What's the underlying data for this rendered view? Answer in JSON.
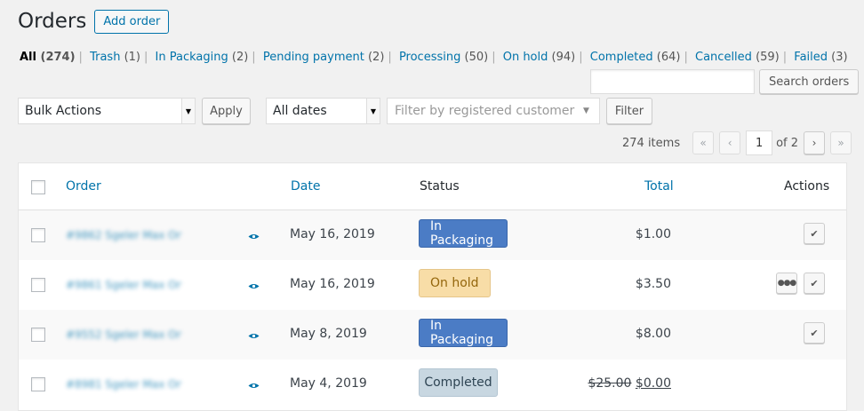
{
  "header": {
    "title": "Orders",
    "add_label": "Add order"
  },
  "filters": [
    {
      "label": "All",
      "count": "(274)",
      "current": true
    },
    {
      "label": "Trash",
      "count": "(1)"
    },
    {
      "label": "In Packaging",
      "count": "(2)"
    },
    {
      "label": "Pending payment",
      "count": "(2)"
    },
    {
      "label": "Processing",
      "count": "(50)"
    },
    {
      "label": "On hold",
      "count": "(94)"
    },
    {
      "label": "Completed",
      "count": "(64)"
    },
    {
      "label": "Cancelled",
      "count": "(59)"
    },
    {
      "label": "Failed",
      "count": "(3)"
    }
  ],
  "filter_separator": "|",
  "search": {
    "value": "",
    "button_label": "Search orders"
  },
  "toolbar": {
    "bulk_actions": "Bulk Actions",
    "apply_label": "Apply",
    "dates": "All dates",
    "customer_placeholder": "Filter by registered customer",
    "filter_label": "Filter"
  },
  "pagination": {
    "items": "274 items",
    "first": "«",
    "prev": "‹",
    "current_page": "1",
    "of": "of 2",
    "next": "›",
    "last": "»"
  },
  "table": {
    "columns": {
      "order": "Order",
      "date": "Date",
      "status": "Status",
      "total": "Total",
      "actions": "Actions"
    },
    "rows": [
      {
        "order": "#9862 Sgeler Max One",
        "date": "May 16, 2019",
        "status": "In Packaging",
        "total": "$1.00"
      },
      {
        "order": "#9861 Sgeler Max One",
        "date": "May 16, 2019",
        "status": "On hold",
        "total": "$3.50"
      },
      {
        "order": "#9552 Sgeler Max One",
        "date": "May 8, 2019",
        "status": "In Packaging",
        "total": "$8.00"
      },
      {
        "order": "#8981 Sgeler Max One",
        "date": "May 4, 2019",
        "status": "Completed",
        "total_old": "$25.00",
        "total": "$0.00"
      }
    ],
    "action_icons": {
      "complete": "check-icon",
      "processing": "ellipsis-icon"
    }
  },
  "colors": {
    "link": "#0073aa",
    "packaging": "#4b7cc5",
    "on_hold": "#f8dda7",
    "completed": "#c8d7e1"
  }
}
